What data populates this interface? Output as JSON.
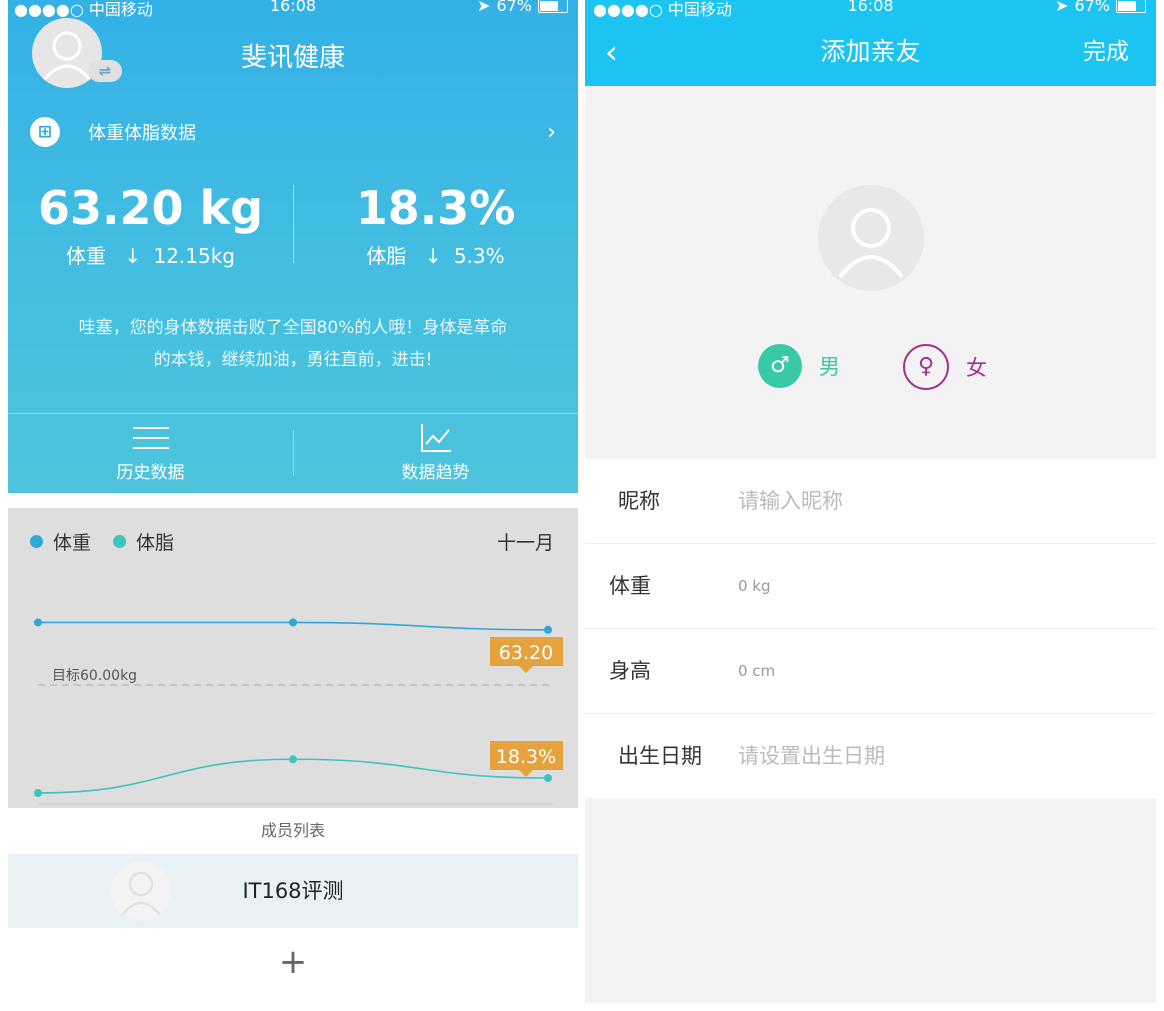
{
  "left": {
    "status": {
      "carrier": "●●●●○ 中国移动",
      "time": "16:08",
      "battery": "67%"
    },
    "title": "斐讯健康",
    "data_row_label": "体重体脂数据",
    "weight": {
      "value": "63.20 kg",
      "label": "体重",
      "change": "12.15kg"
    },
    "fat": {
      "value": "18.3%",
      "label": "体脂",
      "change": "5.3%"
    },
    "message_line1": "哇塞，您的身体数据击败了全国80%的人哦！身体是革命",
    "message_line2": "的本钱，继续加油，勇往直前，进击!",
    "history_label": "历史数据",
    "trend_label": "数据趋势",
    "member_list_label": "成员列表",
    "member_name": "IT168评测",
    "add_symbol": "+"
  },
  "chart_data": {
    "type": "line",
    "legend": [
      "体重",
      "体脂"
    ],
    "month": "十一月",
    "target_label": "目标60.00kg",
    "series": [
      {
        "name": "体重",
        "color": "#2fa6d6",
        "values": [
          63.5,
          63.5,
          63.2
        ],
        "latest_label": "63.20"
      },
      {
        "name": "体脂",
        "color": "#3ec4c0",
        "values": [
          17.9,
          18.8,
          18.3
        ],
        "latest_label": "18.3%"
      }
    ],
    "label_color": "#e6a23c"
  },
  "right": {
    "status": {
      "carrier": "●●●●○ 中国移动",
      "time": "16:08",
      "battery": "67%"
    },
    "back": "‹",
    "title": "添加亲友",
    "done": "完成",
    "male_symbol": "♂",
    "male_label": "男",
    "female_symbol": "♀",
    "female_label": "女",
    "form": {
      "nickname_label": "昵称",
      "nickname_placeholder": "请输入昵称",
      "weight_label": "体重",
      "weight_value": "0 kg",
      "height_label": "身高",
      "height_value": "0 cm",
      "birthday_label": "出生日期",
      "birthday_placeholder": "请设置出生日期"
    }
  }
}
